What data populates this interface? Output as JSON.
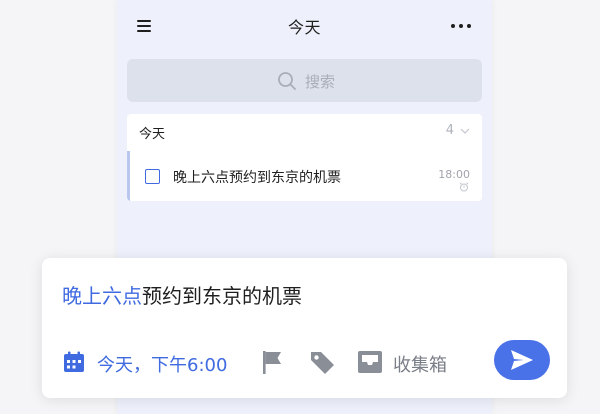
{
  "header": {
    "title": "今天",
    "menu_icon": "hamburger-menu-icon",
    "more_icon": "more-dots-icon"
  },
  "search": {
    "placeholder": "搜索",
    "icon": "search-icon"
  },
  "group": {
    "title": "今天",
    "count": "4",
    "chevron_icon": "chevron-down-icon"
  },
  "tasks": [
    {
      "title": "晚上六点预约到东京的机票",
      "time": "18:00",
      "reminder_icon": "alarm-icon",
      "checked": false
    }
  ],
  "quick_add": {
    "text_highlight": "晚上六点",
    "text_rest": "预约到东京的机票",
    "date_label": "今天，下午6:00",
    "inbox_label": "收集箱",
    "icons": [
      "calendar-icon",
      "flag-icon",
      "tag-icon",
      "inbox-icon",
      "send-icon"
    ]
  },
  "colors": {
    "accent": "#3f6ae0",
    "send_button": "#4a72e8",
    "app_background": "#eef1fb",
    "search_background": "#dde1eb"
  }
}
